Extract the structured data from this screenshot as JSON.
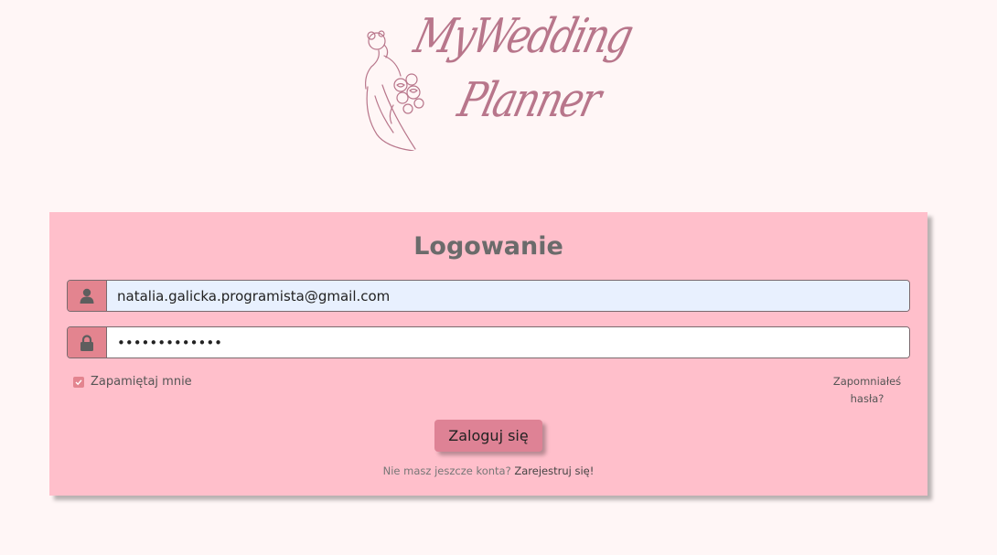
{
  "logo": {
    "line1": "MyWedding",
    "line2": "Planner",
    "icon": "bride-with-bouquet-illustration"
  },
  "login": {
    "title": "Logowanie",
    "email_value": "natalia.galicka.programista@gmail.com",
    "password_value": "•••••••••••••",
    "email_icon": "user-icon",
    "password_icon": "lock-icon",
    "remember_label": "Zapamiętaj mnie",
    "remember_checked": true,
    "forgot_line1": "Zapomniałeś",
    "forgot_line2": "hasła?",
    "submit_label": "Zaloguj się",
    "register_prompt": "Nie masz jeszcze konta?",
    "register_link": "Zarejestruj się!"
  },
  "colors": {
    "page_bg": "#fff6f6",
    "card_bg": "#ffbfcb",
    "accent": "#e3848f",
    "logo": "#b8768b",
    "email_autofill_bg": "#e8f0fe"
  }
}
